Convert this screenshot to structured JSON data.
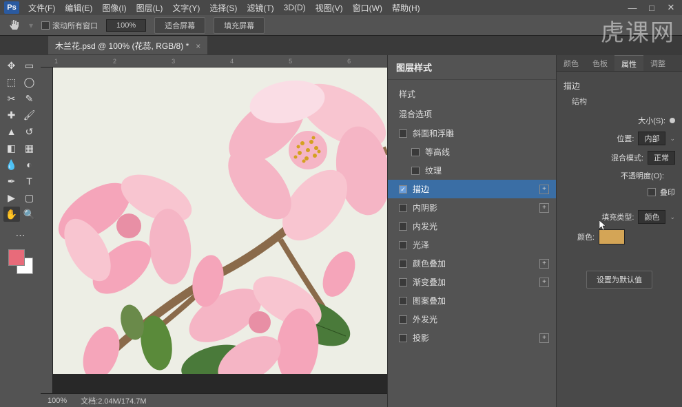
{
  "menu": {
    "items": [
      "文件(F)",
      "编辑(E)",
      "图像(I)",
      "图层(L)",
      "文字(Y)",
      "选择(S)",
      "滤镜(T)",
      "3D(D)",
      "视图(V)",
      "窗口(W)",
      "帮助(H)"
    ]
  },
  "optbar": {
    "scroll_all": "滚动所有窗口",
    "zoom": "100%",
    "fit_screen": "适合屏幕",
    "fill_screen": "填充屏幕"
  },
  "watermark": "虎课网",
  "doc_tab": {
    "title": "木兰花.psd @ 100% (花蕊, RGB/8) *"
  },
  "ruler_h": [
    "1",
    "2",
    "3",
    "4",
    "5",
    "6"
  ],
  "status": {
    "zoom": "100%",
    "doc_size": "文档:2.04M/174.7M"
  },
  "layer_style": {
    "title": "图层样式",
    "styles_head": "样式",
    "blend_head": "混合选项",
    "items": [
      {
        "label": "斜面和浮雕",
        "checked": false,
        "plus": false
      },
      {
        "label": "等高线",
        "checked": false,
        "plus": false,
        "sub": true
      },
      {
        "label": "纹理",
        "checked": false,
        "plus": false,
        "sub": true
      },
      {
        "label": "描边",
        "checked": true,
        "plus": true,
        "active": true
      },
      {
        "label": "内阴影",
        "checked": false,
        "plus": true
      },
      {
        "label": "内发光",
        "checked": false,
        "plus": false
      },
      {
        "label": "光泽",
        "checked": false,
        "plus": false
      },
      {
        "label": "颜色叠加",
        "checked": false,
        "plus": true
      },
      {
        "label": "渐变叠加",
        "checked": false,
        "plus": true
      },
      {
        "label": "图案叠加",
        "checked": false,
        "plus": false
      },
      {
        "label": "外发光",
        "checked": false,
        "plus": false
      },
      {
        "label": "投影",
        "checked": false,
        "plus": true
      }
    ]
  },
  "panel_tabs": [
    "颜色",
    "色板",
    "属性",
    "调整"
  ],
  "stroke_props": {
    "section": "描边",
    "structure": "结构",
    "size_label": "大小(S):",
    "position_label": "位置:",
    "position_val": "内部",
    "blend_label": "混合模式:",
    "blend_val": "正常",
    "opacity_label": "不透明度(O):",
    "overprint_label": "叠印",
    "fill_type_label": "填充类型:",
    "fill_type_val": "颜色",
    "color_label": "颜色:",
    "color_hex": "#d4a556",
    "default_btn": "设置为默认值"
  },
  "swatches": {
    "fg": "#e86b7a"
  }
}
